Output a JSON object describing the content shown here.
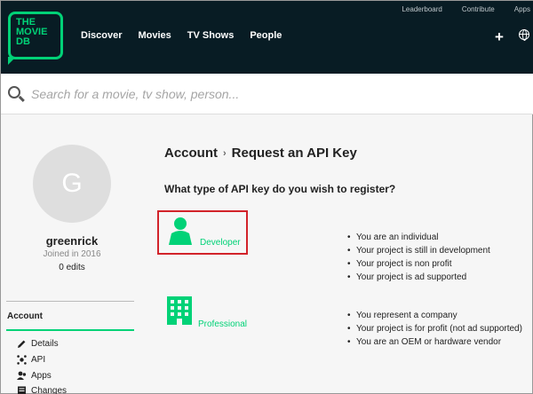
{
  "header": {
    "logo_lines": [
      "THE",
      "MOVIE",
      "DB"
    ],
    "nav": [
      "Discover",
      "Movies",
      "TV Shows",
      "People"
    ],
    "top_links": [
      "Leaderboard",
      "Contribute",
      "Apps"
    ],
    "actions": {
      "add_label": "+",
      "add_icon": "plus-icon",
      "language_icon": "globe-icon"
    }
  },
  "search": {
    "placeholder": "Search for a movie, tv show, person...",
    "value": ""
  },
  "profile": {
    "avatar_letter": "G",
    "username": "greenrick",
    "joined": "Joined in 2016",
    "edits": "0 edits"
  },
  "sidebar": {
    "section": "Account",
    "items": [
      {
        "label": "Details",
        "icon": "pencil-icon"
      },
      {
        "label": "API",
        "icon": "api-icon"
      },
      {
        "label": "Apps",
        "icon": "apps-icon"
      },
      {
        "label": "Changes",
        "icon": "changes-icon"
      }
    ]
  },
  "main": {
    "breadcrumb": {
      "root": "Account",
      "separator": "›",
      "current": "Request an API Key"
    },
    "question": "What type of API key do you wish to register?",
    "options": [
      {
        "label": "Developer",
        "icon": "person-icon",
        "selected": true,
        "bullets": [
          "You are an individual",
          "Your project is still in development",
          "Your project is non profit",
          "Your project is ad supported"
        ]
      },
      {
        "label": "Professional",
        "icon": "building-icon",
        "selected": false,
        "bullets": [
          "You represent a company",
          "Your project is for profit (not ad supported)",
          "You are an OEM or hardware vendor"
        ]
      }
    ]
  },
  "colors": {
    "brand_green": "#01d277",
    "header_bg": "#081c24",
    "highlight_red": "#d2232a"
  }
}
